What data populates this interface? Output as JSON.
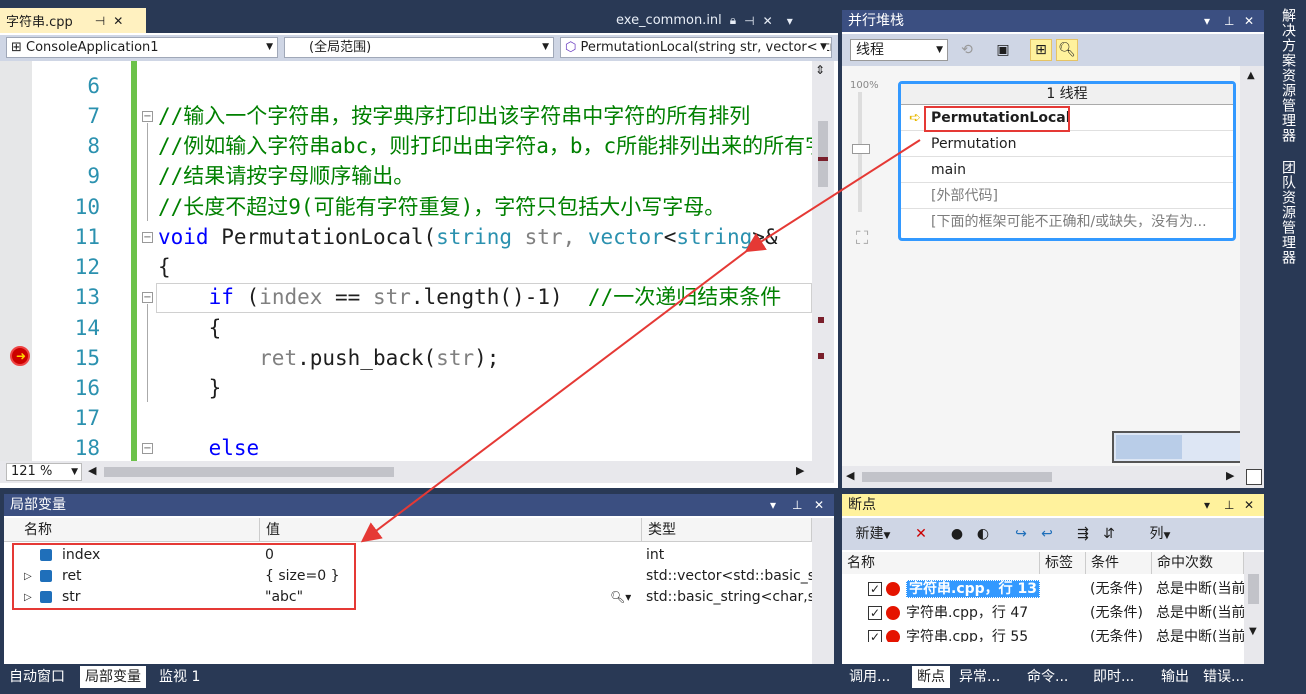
{
  "editor": {
    "active_tab": "字符串.cpp",
    "other_tab": "exe_common.inl",
    "project_combo": "ConsoleApplication1",
    "scope_combo": "(全局范围)",
    "function_combo": "PermutationLocal(string str, vector<string>&",
    "zoom": "121 %",
    "line_numbers": [
      "6",
      "7",
      "8",
      "9",
      "10",
      "11",
      "12",
      "13",
      "14",
      "15",
      "16",
      "17",
      "18"
    ],
    "lines": {
      "l7": "//输入一个字符串，按字典序打印出该字符串中字符的所有排列",
      "l8": "//例如输入字符串abc，则打印出由字符a，b，c所能排列出来的所有字符串",
      "l9": "//结果请按字母顺序输出。",
      "l10": "//长度不超过9(可能有字符重复)，字符只包括大小写字母。",
      "l11_kw": "void",
      "l11_fn": " PermutationLocal(",
      "l11_ty1": "string",
      "l11_p1": " str, ",
      "l11_ty2": "vector",
      "l11_p2": "<",
      "l11_ty3": "string",
      "l11_p3": ">&",
      "l12": "{",
      "l13_kw": "if",
      "l13_a": " (",
      "l13_idx": "index",
      "l13_b": " == ",
      "l13_str": "str",
      "l13_c": ".length()-1)  ",
      "l13_cm": "//一次递归结束条件",
      "l14": "{",
      "l15_ret": "ret",
      "l15_a": ".push_back(",
      "l15_str": "str",
      "l15_b": ");",
      "l16": "}",
      "l18": "else"
    }
  },
  "parallel_stacks": {
    "title": "并行堆栈",
    "thread_combo": "线程",
    "zoom_label": "100%",
    "box_title": "1 线程",
    "frames": [
      "PermutationLocal",
      "Permutation",
      "main",
      "[外部代码]",
      "[下面的框架可能不正确和/或缺失，没有为..."
    ]
  },
  "locals": {
    "title": "局部变量",
    "columns": [
      "名称",
      "值",
      "类型"
    ],
    "rows": [
      {
        "name": "index",
        "value": "0",
        "type": "int"
      },
      {
        "name": "ret",
        "value": "{ size=0 }",
        "type": "std::vector<std::basic_string"
      },
      {
        "name": "str",
        "value": "\"abc\"",
        "type": "std::basic_string<char,std"
      }
    ],
    "tabs": [
      "自动窗口",
      "局部变量",
      "监视 1"
    ]
  },
  "breakpoints": {
    "title": "断点",
    "new_label": "新建",
    "columns_btn": "列",
    "columns": [
      "名称",
      "标签",
      "条件",
      "命中次数"
    ],
    "rows": [
      {
        "name": "字符串.cpp，行 13",
        "cond": "(无条件)",
        "hit": "总是中断(当前"
      },
      {
        "name": "字符串.cpp，行 47",
        "cond": "(无条件)",
        "hit": "总是中断(当前"
      },
      {
        "name": "字符串.cpp，行 55",
        "cond": "(无条件)",
        "hit": "总是中断(当前"
      }
    ],
    "tabs": [
      "调用...",
      "断点",
      "异常...",
      "命令...",
      "即时...",
      "输出",
      "错误..."
    ]
  },
  "side": {
    "solution_explorer": "解决方案资源管理器",
    "team_explorer": "团队资源管理器"
  },
  "colors": {
    "accent": "#3399ff",
    "highlight": "#e53935",
    "chrome": "#293955"
  }
}
